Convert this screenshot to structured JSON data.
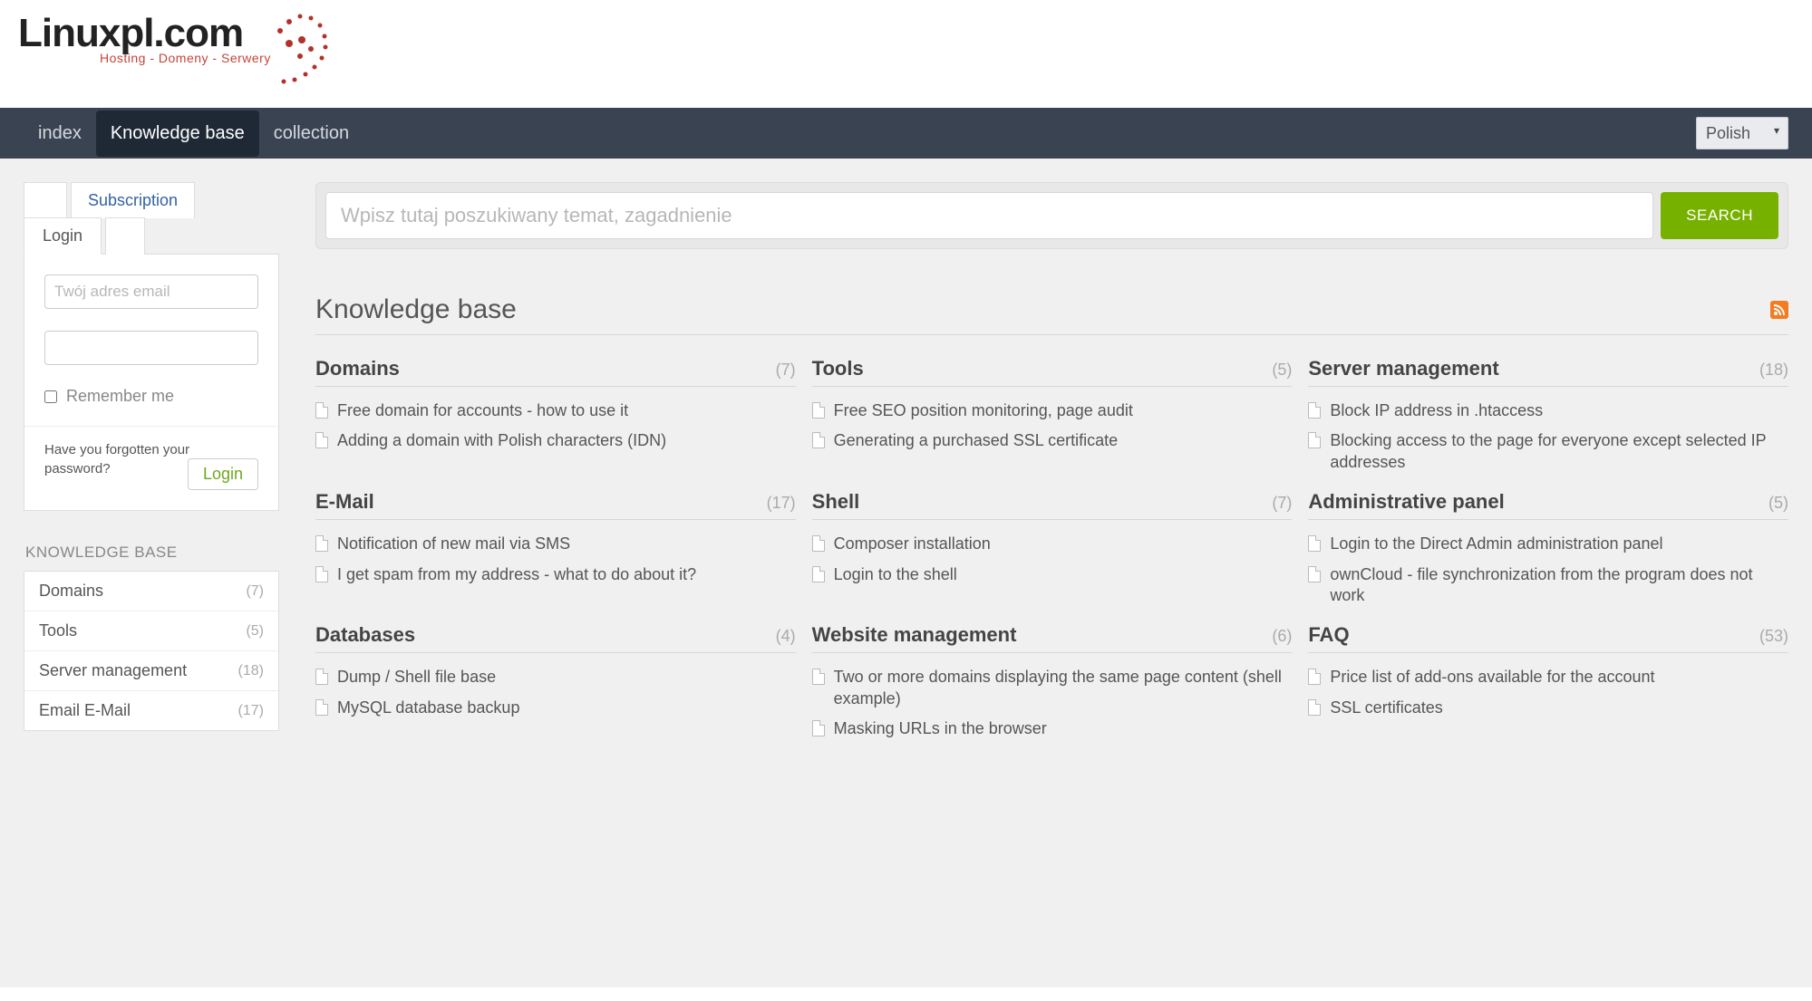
{
  "logo": {
    "main": "Linuxpl.com",
    "sub": "Hosting - Domeny - Serwery"
  },
  "nav": {
    "items": [
      {
        "label": "index",
        "active": false
      },
      {
        "label": "Knowledge base",
        "active": true
      },
      {
        "label": "collection",
        "active": false
      }
    ],
    "language": "Polish"
  },
  "sidebar": {
    "top_tabs": {
      "subscription": "Subscription"
    },
    "secondary_tabs": {
      "login": "Login"
    },
    "login": {
      "email_placeholder": "Twój adres email",
      "remember_label": "Remember me",
      "forgot": "Have you forgotten your password?",
      "button": "Login"
    },
    "kb_heading": "KNOWLEDGE BASE",
    "kb_items": [
      {
        "label": "Domains",
        "count": "(7)"
      },
      {
        "label": "Tools",
        "count": "(5)"
      },
      {
        "label": "Server management",
        "count": "(18)"
      },
      {
        "label": "Email E-Mail",
        "count": "(17)"
      }
    ]
  },
  "search": {
    "placeholder": "Wpisz tutaj poszukiwany temat, zagadnienie",
    "button": "SEARCH"
  },
  "page_title": "Knowledge base",
  "categories": [
    {
      "name": "Domains",
      "count": "(7)",
      "items": [
        "Free domain for accounts - how to use it",
        "Adding a domain with Polish characters (IDN)"
      ]
    },
    {
      "name": "Tools",
      "count": "(5)",
      "items": [
        "Free SEO position monitoring, page audit",
        "Generating a purchased SSL certificate"
      ]
    },
    {
      "name": "Server management",
      "count": "(18)",
      "items": [
        "Block IP address in .htaccess",
        "Blocking access to the page for everyone except selected IP addresses"
      ]
    },
    {
      "name": "E-Mail",
      "count": "(17)",
      "items": [
        "Notification of new mail via SMS",
        "I get spam from my address - what to do about it?"
      ]
    },
    {
      "name": "Shell",
      "count": "(7)",
      "items": [
        "Composer installation",
        "Login to the shell"
      ]
    },
    {
      "name": "Administrative panel",
      "count": "(5)",
      "items": [
        "Login to the Direct Admin administration panel",
        "ownCloud - file synchronization from the program does not work"
      ]
    },
    {
      "name": "Databases",
      "count": "(4)",
      "items": [
        "Dump / Shell file base",
        "MySQL database backup"
      ]
    },
    {
      "name": "Website management",
      "count": "(6)",
      "items": [
        "Two or more domains displaying the same page content (shell example)",
        "Masking URLs in the browser"
      ]
    },
    {
      "name": "FAQ",
      "count": "(53)",
      "items": [
        "Price list of add-ons available for the account",
        "SSL certificates"
      ]
    }
  ]
}
